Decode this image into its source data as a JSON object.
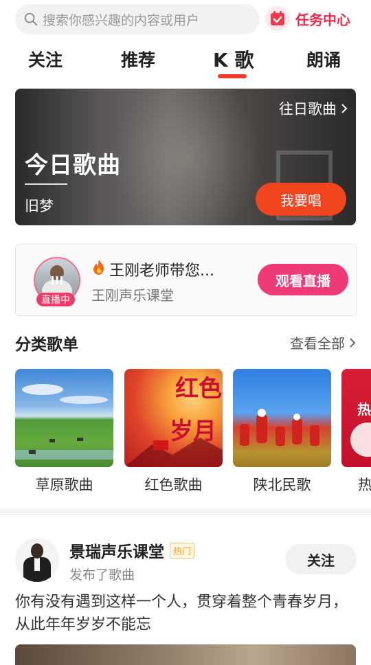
{
  "search": {
    "placeholder": "搜索你感兴趣的内容或用户"
  },
  "task_center": {
    "label": "任务中心"
  },
  "tabs": [
    {
      "label": "关注",
      "active": false
    },
    {
      "label": "推荐",
      "active": false
    },
    {
      "label": "K 歌",
      "active": true
    },
    {
      "label": "朗诵",
      "active": false
    }
  ],
  "banner": {
    "title": "今日歌曲",
    "song": "旧梦",
    "past_link": "往日歌曲",
    "sing_button": "我要唱"
  },
  "live": {
    "badge": "直播中",
    "title": "王刚老师带您...",
    "subtitle": "王刚声乐课堂",
    "watch_button": "观看直播"
  },
  "category": {
    "title": "分类歌单",
    "more": "查看全部",
    "items": [
      {
        "label": "草原歌曲"
      },
      {
        "label": "红色歌曲"
      },
      {
        "label": "陕北民歌"
      },
      {
        "label": "热"
      }
    ],
    "cover_text": {
      "hongse": "红色岁月",
      "partial": "热"
    }
  },
  "post": {
    "author": "景瑞声乐课堂",
    "tag": "热门",
    "action": "发布了歌曲",
    "follow_button": "关注",
    "text": "你有没有遇到这样一个人，贯穿着整个青春岁月，从此年年岁岁不能忘"
  },
  "colors": {
    "accent": "#ee3b2c",
    "live_pink": "#ef3a78",
    "task_red": "#ee2a4a"
  }
}
